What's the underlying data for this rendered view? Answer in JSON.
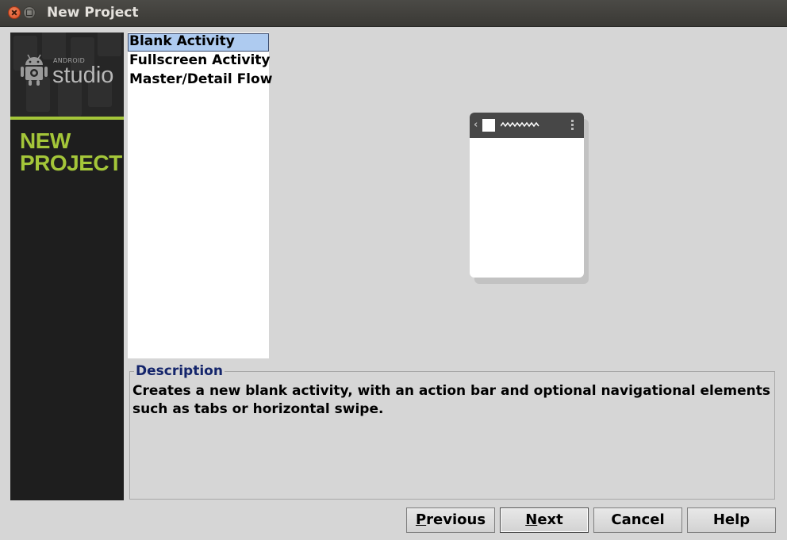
{
  "window": {
    "title": "New Project"
  },
  "sidebar": {
    "brand_small": "ANDROID",
    "brand_large": "studio",
    "heading_line1": "NEW",
    "heading_line2": "PROJECT",
    "accent_color": "#a4c639"
  },
  "templates": {
    "items": [
      {
        "label": "Blank Activity",
        "selected": true
      },
      {
        "label": "Fullscreen Activity",
        "selected": false
      },
      {
        "label": "Master/Detail Flow",
        "selected": false
      }
    ],
    "selection_color": "#aecbf0"
  },
  "description": {
    "legend": "Description",
    "text": "Creates a new blank activity, with an action bar and optional navigational elements such as tabs or horizontal swipe."
  },
  "buttons": {
    "previous": {
      "mnemonic": "P",
      "rest": "revious"
    },
    "next": {
      "mnemonic": "N",
      "rest": "ext"
    },
    "cancel": "Cancel",
    "help": "Help"
  }
}
